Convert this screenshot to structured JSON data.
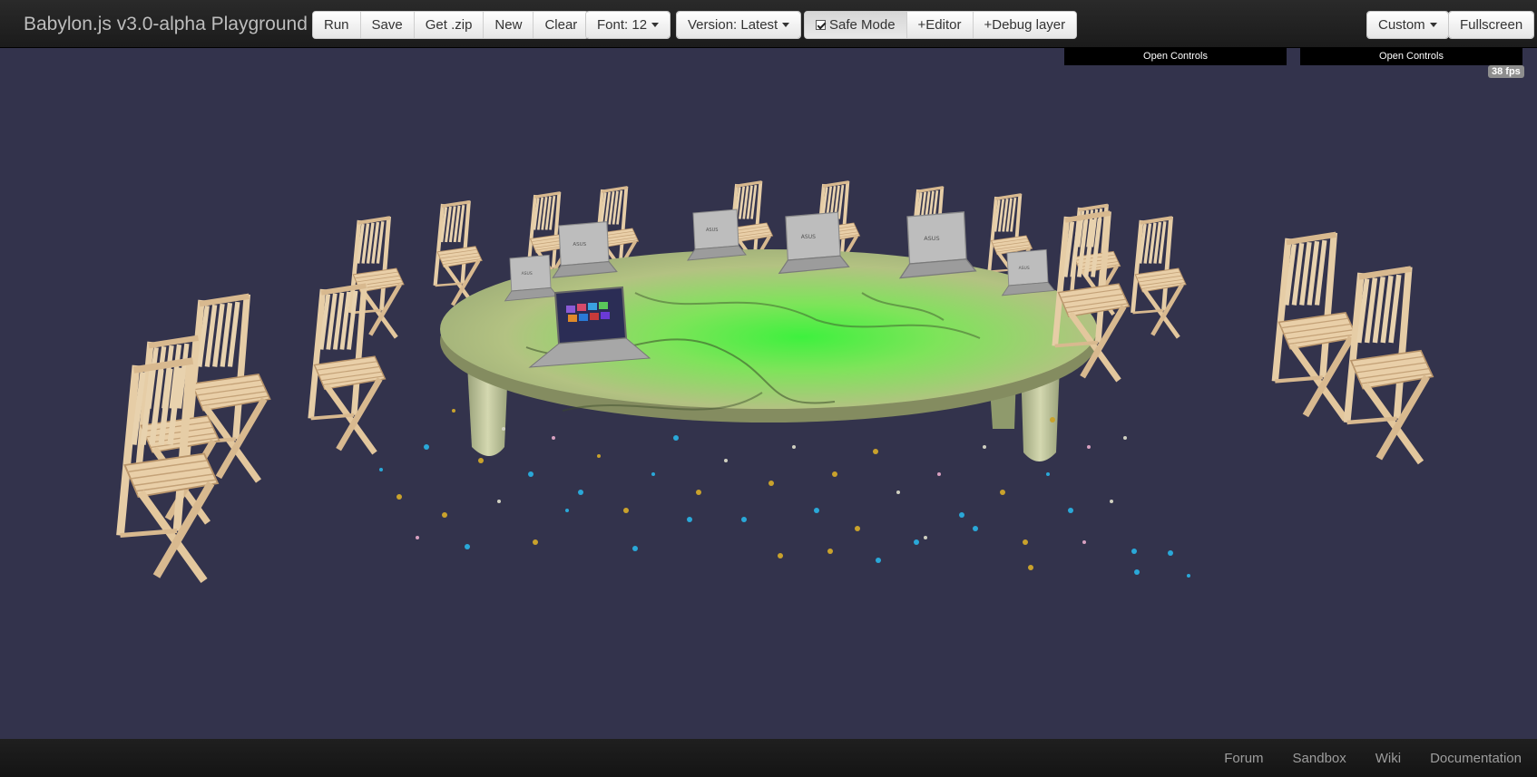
{
  "navbar": {
    "brand": "Babylon.js v3.0-alpha Playground",
    "actions": {
      "run": "Run",
      "save": "Save",
      "get_zip": "Get .zip",
      "new": "New",
      "clear": "Clear"
    },
    "font_dropdown": "Font: 12",
    "version_dropdown": "Version: Latest",
    "safe_mode": {
      "label": "Safe Mode",
      "checked": true
    },
    "editor_toggle": "+Editor",
    "debug_toggle": "+Debug layer",
    "custom_dropdown": "Custom",
    "fullscreen": "Fullscreen"
  },
  "canvas": {
    "open_controls_left": "Open Controls",
    "open_controls_right": "Open Controls",
    "fps": "38 fps",
    "background_color": "#33334c",
    "table_top_color": "#a8c47a",
    "table_highlight_color": "#3ef13e",
    "chair_color": "#e8cfa8",
    "laptop_color": "#b5b5b5",
    "particle_colors": [
      "#2aa8d8",
      "#c9a22c",
      "#d0d0c0",
      "#d8a0c0"
    ]
  },
  "footer": {
    "links": [
      "Forum",
      "Sandbox",
      "Wiki",
      "Documentation"
    ]
  }
}
